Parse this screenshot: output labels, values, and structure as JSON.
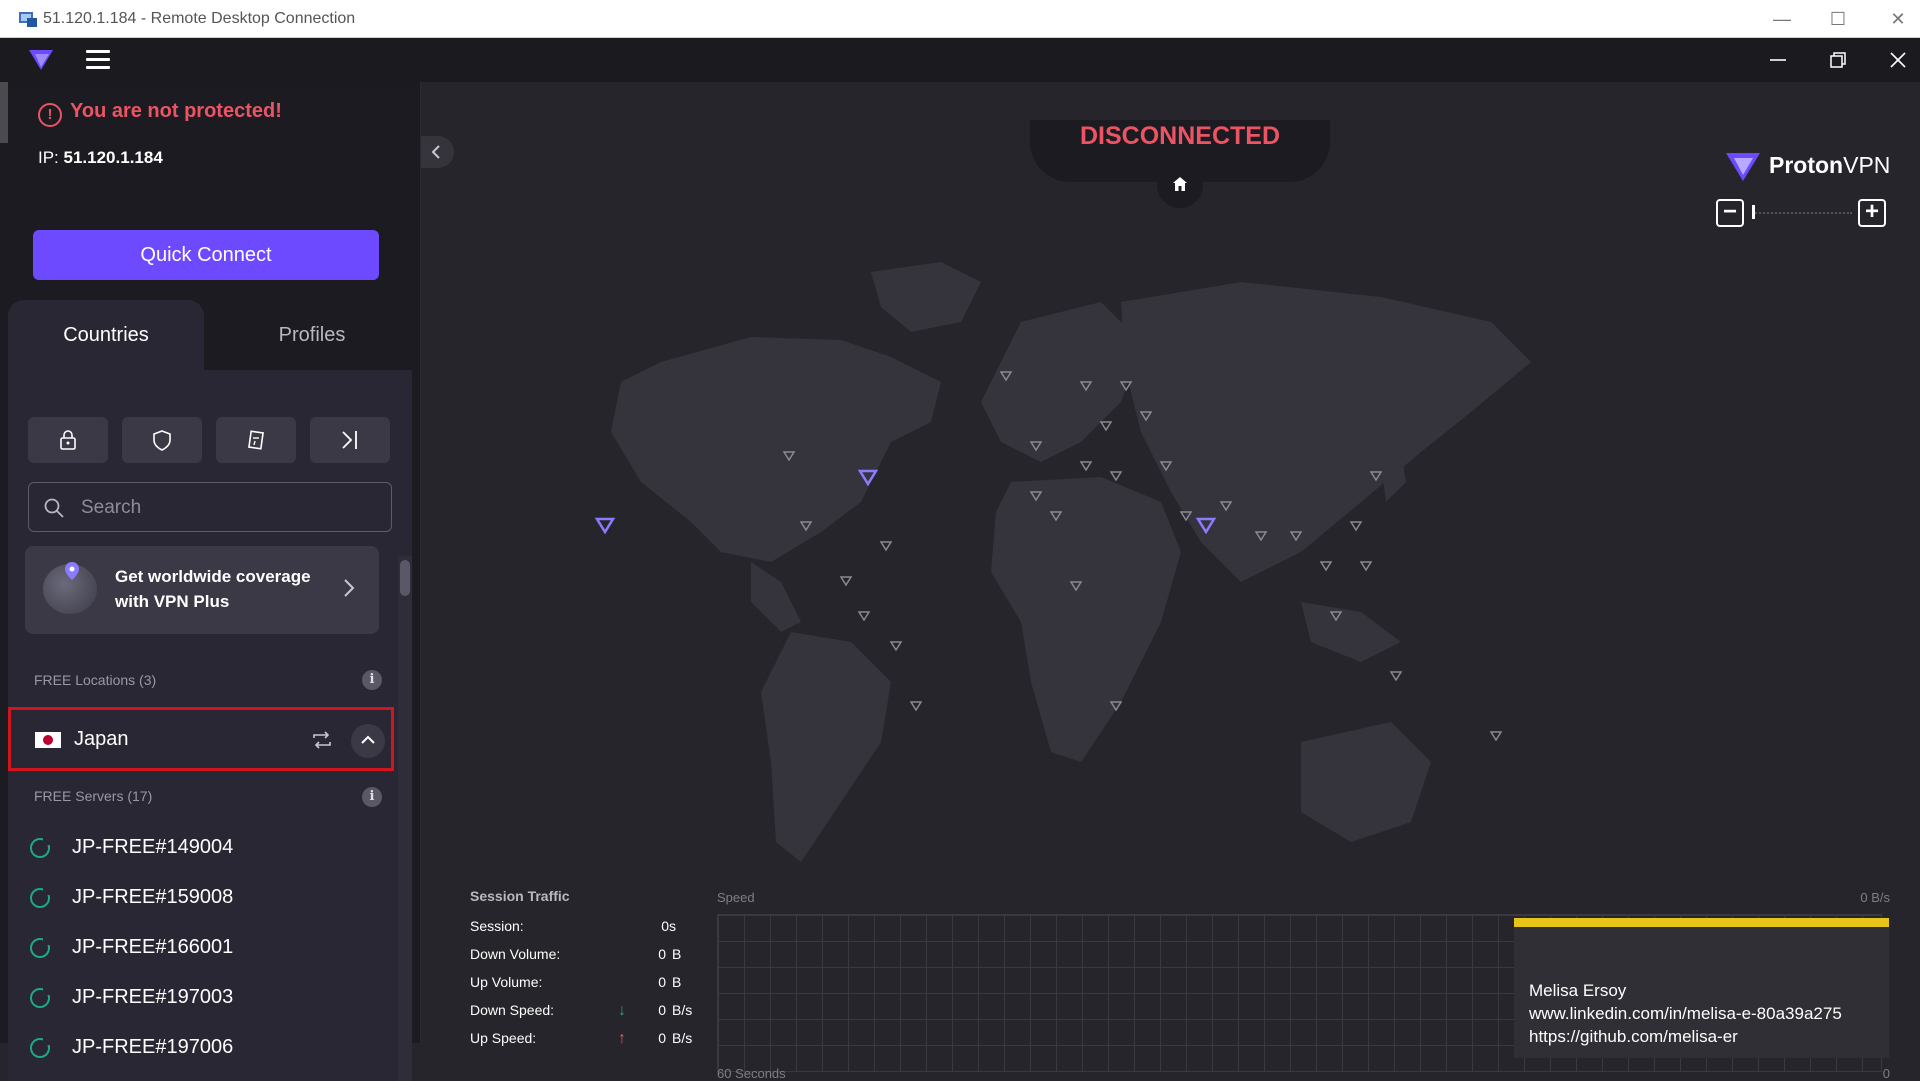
{
  "rdp": {
    "title": "51.120.1.184 - Remote Desktop Connection",
    "minimize": "—",
    "maximize": "☐",
    "close": "✕"
  },
  "status": {
    "warning": "You are not protected!",
    "ip_label": "IP: ",
    "ip": "51.120.1.184",
    "connection": "DISCONNECTED"
  },
  "quick_connect": "Quick Connect",
  "tabs": [
    "Countries",
    "Profiles"
  ],
  "filters": [
    "secure-core-icon",
    "netshield-icon",
    "p2p-icon",
    "tor-icon"
  ],
  "search": {
    "placeholder": "Search"
  },
  "promo": {
    "text": "Get worldwide coverage with VPN Plus"
  },
  "free_locations": {
    "label": "FREE Locations (3)"
  },
  "country": {
    "name": "Japan"
  },
  "free_servers": {
    "label": "FREE Servers (17)"
  },
  "servers": [
    "JP-FREE#149004",
    "JP-FREE#159008",
    "JP-FREE#166001",
    "JP-FREE#197003",
    "JP-FREE#197006"
  ],
  "brand": {
    "name_bold": "Proton",
    "name_light": "VPN"
  },
  "traffic": {
    "title": "Session Traffic",
    "rows": [
      {
        "label": "Session:",
        "value": "0s",
        "unit": "",
        "arrow": ""
      },
      {
        "label": "Down Volume:",
        "value": "0",
        "unit": "B",
        "arrow": ""
      },
      {
        "label": "Up Volume:",
        "value": "0",
        "unit": "B",
        "arrow": ""
      },
      {
        "label": "Down Speed:",
        "value": "0",
        "unit": "B/s",
        "arrow": "↓"
      },
      {
        "label": "Up Speed:",
        "value": "0",
        "unit": "B/s",
        "arrow": "↑"
      }
    ],
    "speed_label": "Speed",
    "speed_value": "0  B/s",
    "time_label": "60 Seconds",
    "time_end": "0"
  },
  "toast": {
    "name": "Melisa Ersoy",
    "linkedin": "www.linkedin.com/in/melisa-e-80a39a275",
    "github": "https://github.com/melisa-er"
  },
  "colors": {
    "accent": "#6d4aff",
    "danger": "#ec5463",
    "server_ring": "#1ea885",
    "highlight_box": "#d0151f",
    "toast_bar": "#e8c31a"
  }
}
